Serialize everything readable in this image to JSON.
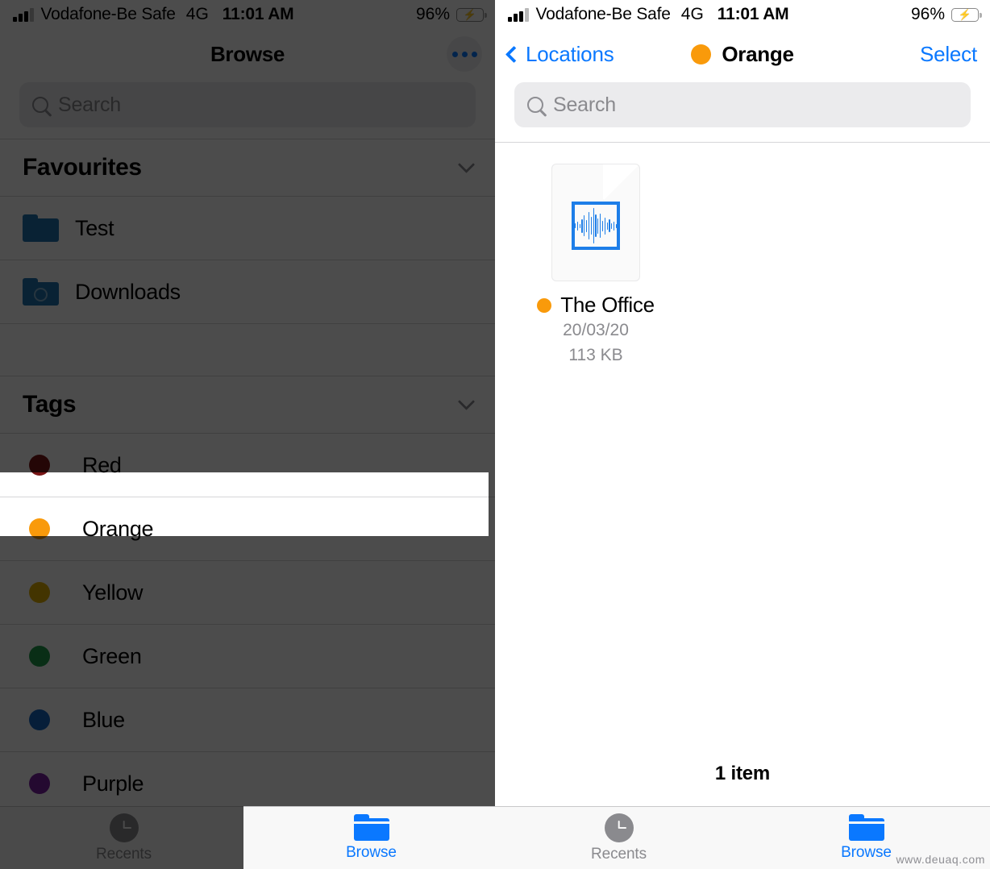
{
  "colors": {
    "accent_blue": "#0a78ff",
    "tag_red": "#d32f2f",
    "tag_orange": "#f99a0b",
    "tag_yellow": "#e0b000",
    "tag_green": "#1f9c4a",
    "tag_blue": "#1565c0",
    "tag_purple": "#7b1fa2",
    "folder_blue": "#1f74ad",
    "battery_green": "#2fd158"
  },
  "status_bar": {
    "carrier": "Vodafone-Be Safe",
    "network": "4G",
    "time": "11:01 AM",
    "battery_percent": "96%",
    "signal_icon": "signal-bars-icon",
    "battery_icon": "battery-charging-icon"
  },
  "left_screen": {
    "nav": {
      "title": "Browse",
      "more_icon": "ellipsis-circle-icon"
    },
    "search": {
      "placeholder": "Search",
      "value": "",
      "icon": "search-icon"
    },
    "sections": [
      {
        "title": "Favourites",
        "collapse_icon": "chevron-down-icon",
        "items": [
          {
            "label": "Test",
            "icon": "folder-icon"
          },
          {
            "label": "Downloads",
            "icon": "folder-download-icon"
          }
        ]
      },
      {
        "title": "Tags",
        "collapse_icon": "chevron-down-icon",
        "items": [
          {
            "label": "Red",
            "color": "#7a1616",
            "icon": "tag-dot-icon",
            "highlighted": false
          },
          {
            "label": "Orange",
            "color": "#f99a0b",
            "icon": "tag-dot-icon",
            "highlighted": true
          },
          {
            "label": "Yellow",
            "color": "#e0b000",
            "icon": "tag-dot-icon",
            "highlighted": false
          },
          {
            "label": "Green",
            "color": "#1f9c4a",
            "icon": "tag-dot-icon",
            "highlighted": false
          },
          {
            "label": "Blue",
            "color": "#1565c0",
            "icon": "tag-dot-icon",
            "highlighted": false
          },
          {
            "label": "Purple",
            "color": "#7b1fa2",
            "icon": "tag-dot-icon",
            "highlighted": false
          }
        ]
      }
    ],
    "tabbar": [
      {
        "label": "Recents",
        "icon": "clock-icon",
        "active": false
      },
      {
        "label": "Browse",
        "icon": "folder-icon",
        "active": true
      }
    ]
  },
  "right_screen": {
    "nav": {
      "back_label": "Locations",
      "back_icon": "chevron-left-icon",
      "title": "Orange",
      "title_dot_color": "#f99a0b",
      "select_label": "Select"
    },
    "search": {
      "placeholder": "Search",
      "value": "",
      "icon": "search-icon"
    },
    "files": [
      {
        "name": "The Office",
        "date": "20/03/20",
        "size": "113 KB",
        "tag_dot_color": "#f99a0b",
        "icon": "audio-document-icon"
      }
    ],
    "item_count": "1 item",
    "tabbar": [
      {
        "label": "Recents",
        "icon": "clock-icon",
        "active": false
      },
      {
        "label": "Browse",
        "icon": "folder-icon",
        "active": true
      }
    ]
  },
  "watermark": "www.deuaq.com"
}
